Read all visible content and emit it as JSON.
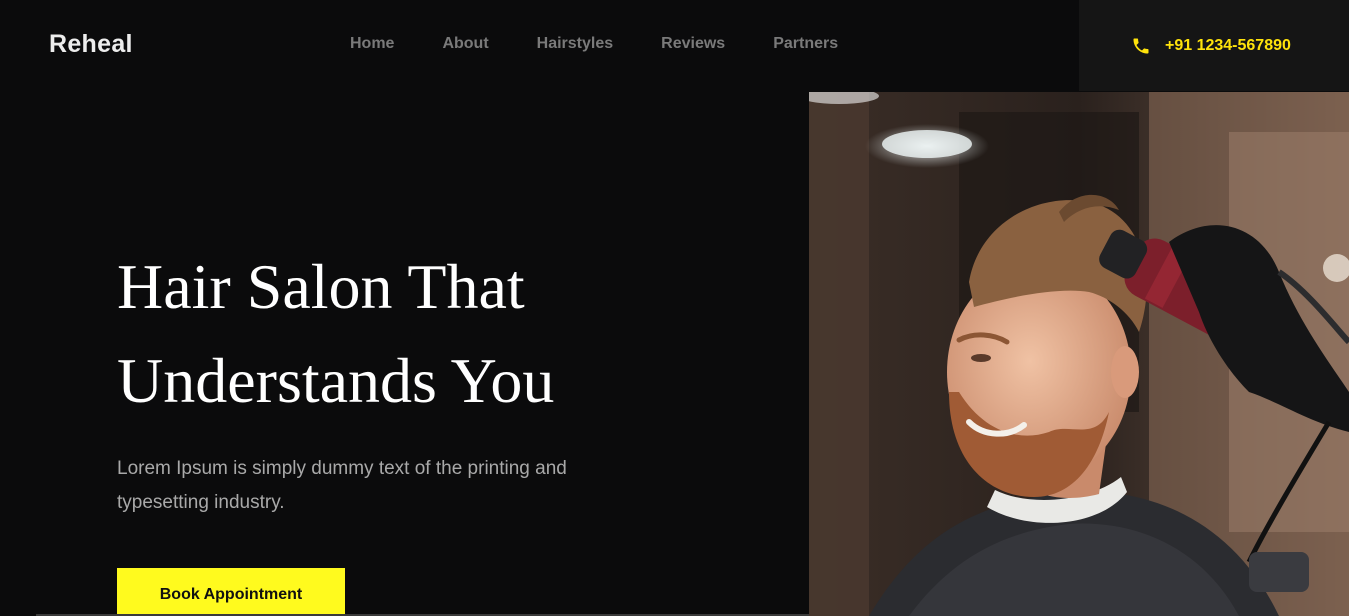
{
  "brand": {
    "name": "Reheal"
  },
  "nav": {
    "items": [
      {
        "label": "Home"
      },
      {
        "label": "About"
      },
      {
        "label": "Hairstyles"
      },
      {
        "label": "Reviews"
      },
      {
        "label": "Partners"
      }
    ]
  },
  "contact": {
    "icon": "phone-icon",
    "phone": "+91 1234-567890"
  },
  "hero": {
    "title_line1": "Hair Salon That",
    "title_line2": "Understands You",
    "description": "Lorem Ipsum is simply dummy text of the printing and typesetting industry.",
    "cta_label": "Book Appointment",
    "image_subject": "barber-styling-customer-hair-with-dryer"
  },
  "colors": {
    "background": "#0b0b0c",
    "accent": "#fffa1e",
    "phone_text": "#ffe30b",
    "nav_text": "#7a7a7a"
  }
}
